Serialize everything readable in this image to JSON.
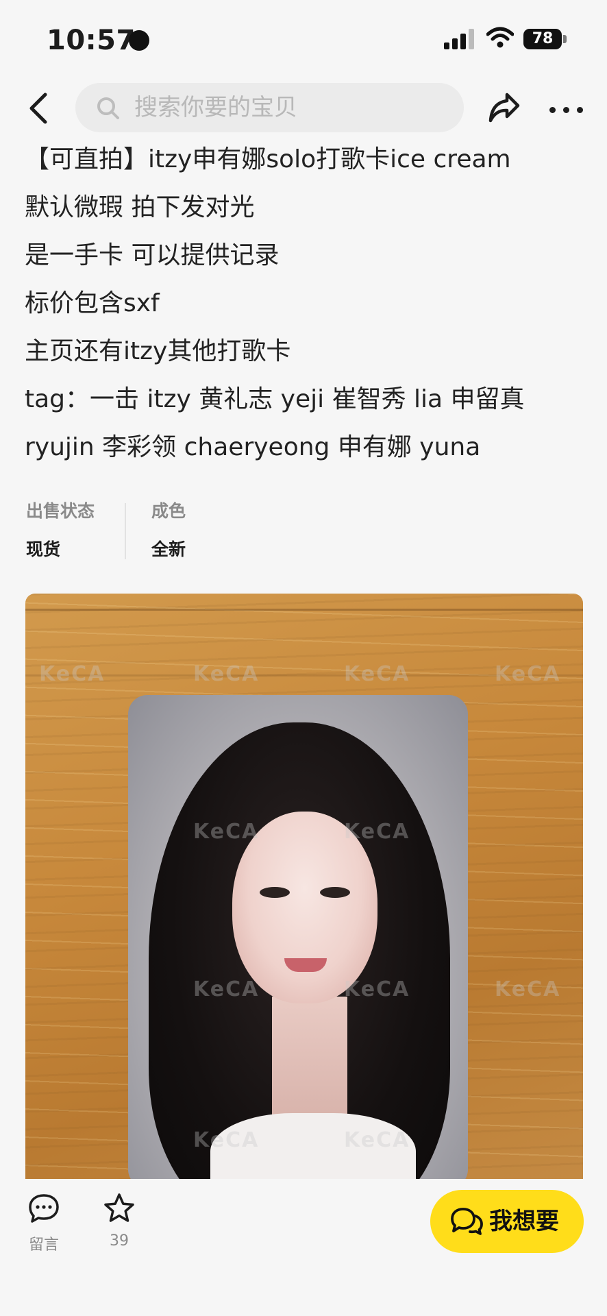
{
  "status_bar": {
    "time": "10:57",
    "battery": "78"
  },
  "header": {
    "search_placeholder": "搜索你要的宝贝"
  },
  "description": {
    "lines": [
      "【可直拍】itzy申有娜solo打歌卡ice cream",
      "默认微瑕 拍下发对光",
      "是一手卡 可以提供记录",
      "标价包含sxf",
      "主页还有itzy其他打歌卡",
      "tag：一击 itzy 黄礼志 yeji 崔智秀 lia 申留真",
      "ryujin 李彩领 chaeryeong 申有娜 yuna"
    ]
  },
  "attributes": [
    {
      "label": "出售状态",
      "value": "现货"
    },
    {
      "label": "成色",
      "value": "全新"
    }
  ],
  "photo": {
    "watermark": "KeCA"
  },
  "bottom_bar": {
    "comment_label": "留言",
    "favorite_count": "39",
    "want_label": "我想要"
  },
  "colors": {
    "accent": "#ffdd1a",
    "background": "#f6f6f6",
    "text": "#1c1c1c",
    "muted": "#8a8a8a"
  },
  "icons": [
    "back-arrow-icon",
    "search-icon",
    "share-icon",
    "more-icon",
    "comment-icon",
    "star-icon",
    "chat-bubbles-icon"
  ]
}
